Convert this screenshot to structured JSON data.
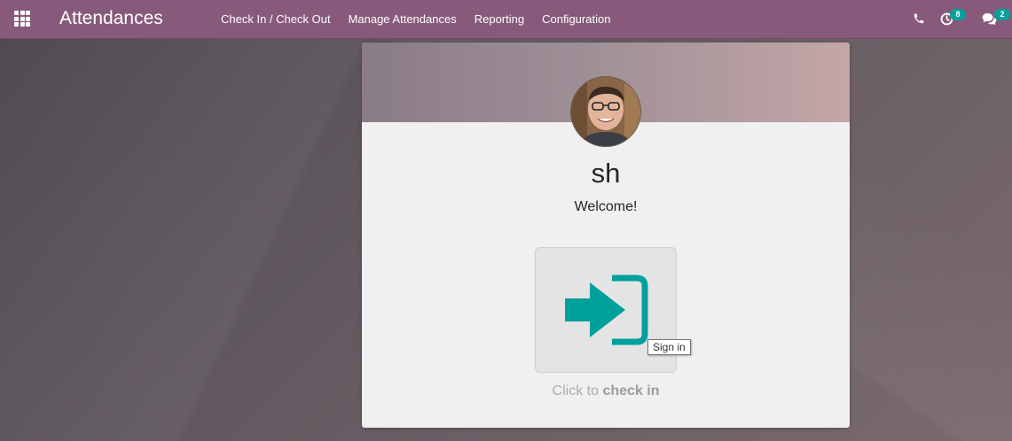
{
  "app": {
    "title": "Attendances"
  },
  "menu": {
    "items": [
      {
        "label": "Check In / Check Out"
      },
      {
        "label": "Manage Attendances"
      },
      {
        "label": "Reporting"
      },
      {
        "label": "Configuration"
      }
    ]
  },
  "systray": {
    "phone_icon": "phone-icon",
    "activity_icon": "clock-icon",
    "activity_count": "8",
    "messaging_icon": "chat-icon",
    "messaging_count": "2"
  },
  "employee": {
    "name": "sh",
    "greeting": "Welcome!"
  },
  "checkin": {
    "tooltip": "Sign in",
    "hint_prefix": "Click to",
    "hint_action": "check in",
    "icon": "sign-in-icon"
  },
  "colors": {
    "navbar": "#875a7b",
    "accent": "#00a09d",
    "badge": "#00a09d"
  }
}
